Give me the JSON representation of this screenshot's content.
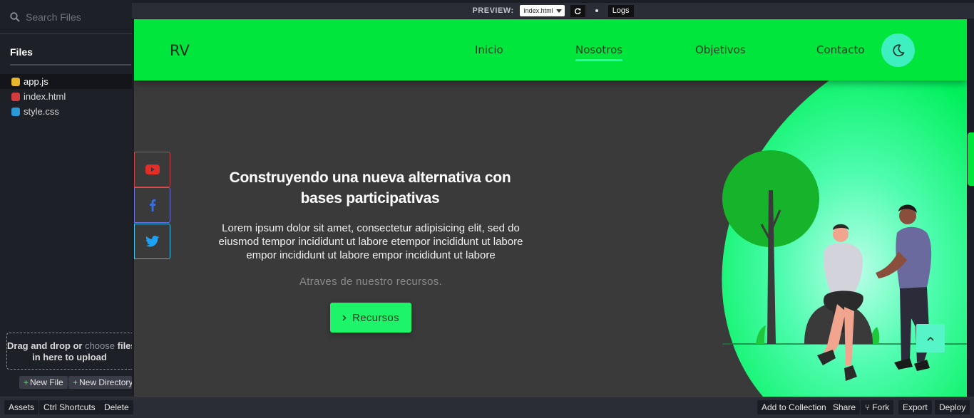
{
  "sidebar": {
    "search_placeholder": "Search Files",
    "files_title": "Files",
    "files": [
      {
        "name": "app.js",
        "type": "js",
        "active": true
      },
      {
        "name": "index.html",
        "type": "html",
        "active": false
      },
      {
        "name": "style.css",
        "type": "css",
        "active": false
      }
    ],
    "upload": {
      "text_1": "Drag and drop or",
      "choose": "choose",
      "text_2": "files",
      "text_3": "in here to upload"
    },
    "new_file": "New File",
    "new_directory": "New Directory"
  },
  "preview_bar": {
    "label": "PREVIEW:",
    "selected_file": "index.html",
    "refresh_icon": "refresh-icon",
    "logs": "Logs"
  },
  "site": {
    "brand": "RV",
    "nav": [
      {
        "label": "Inicio",
        "active": false
      },
      {
        "label": "Nosotros",
        "active": true
      },
      {
        "label": "Objetivos",
        "active": false
      },
      {
        "label": "Contacto",
        "active": false
      }
    ],
    "theme_icon": "moon-icon",
    "social": [
      "youtube-icon",
      "facebook-icon",
      "twitter-icon"
    ],
    "hero": {
      "title": "Construyendo una nueva alternativa con bases participativas",
      "text": "Lorem ipsum dolor sit amet, consectetur adipisicing elit, sed do eiusmod tempor incididunt ut labore etempor incididunt ut labore empor incididunt ut labore empor incididunt ut labore",
      "subtitle": "Atraves de nuestro recursos.",
      "button": "Recursos"
    },
    "colors": {
      "nav_green": "#00e63c",
      "accent_mint": "#2ef7a6",
      "button_green": "#1ef46a",
      "background": "#3a3a3a"
    }
  },
  "bottom_bar": {
    "left": [
      "Assets",
      "Ctrl Shortcuts",
      "Delete"
    ],
    "right": [
      "Add to Collection",
      "Share",
      "Fork",
      "Export",
      "Deploy"
    ]
  }
}
